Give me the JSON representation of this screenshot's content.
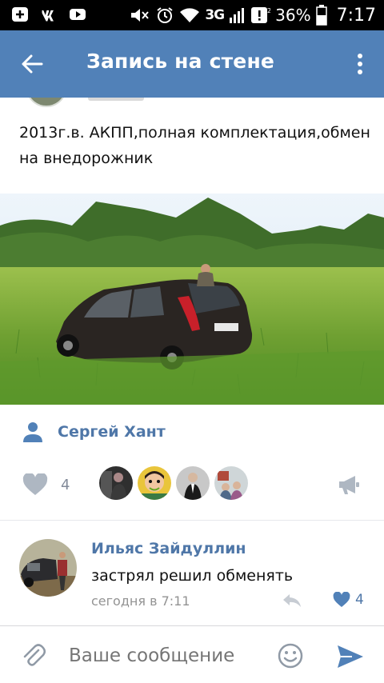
{
  "status_bar": {
    "network": "3G",
    "battery_percent": "36%",
    "time": "7:17",
    "icons": [
      "add-icon",
      "vk-icon",
      "youtube-icon",
      "mute-icon",
      "alarm-icon",
      "wifi-icon",
      "signal-icon",
      "notification-icon",
      "battery-icon"
    ]
  },
  "header": {
    "title": "Запись на стене",
    "back_icon": "arrow-back-icon",
    "menu_icon": "more-vertical-icon",
    "color": "#5181b8"
  },
  "post": {
    "text": "2013г.в. АКПП,полная комплектация,обмен на внедорожник",
    "author": "Сергей Хант",
    "likes_count": "4",
    "liker_avatars": 4
  },
  "comment": {
    "author": "Ильяс Зайдуллин",
    "text": "застрял решил обменять",
    "time": "сегодня в 7:11",
    "likes_count": "4"
  },
  "composer": {
    "placeholder": "Ваше сообщение"
  },
  "colors": {
    "link": "#4f77a8",
    "secondary": "#828a99",
    "accent": "#5181b8"
  }
}
